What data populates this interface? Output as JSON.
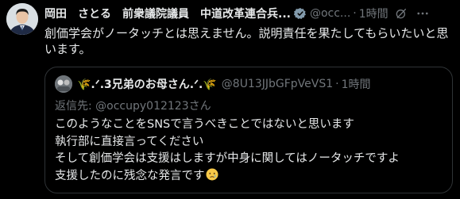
{
  "tweet": {
    "display_name": "岡田　さとる　前衆議院議員　中道改革連合兵...",
    "handle": "@occ...",
    "separator": "·",
    "time": "1時間",
    "text": "創価学会がノータッチとは思えません。説明責任を果たしてもらいたいと思います。"
  },
  "quote": {
    "display_name": "🌾.ᐟ.3兄弟のお母さん.ᐟ.🌾",
    "handle": "@8U13JJbGFpVeVS1",
    "separator": "·",
    "time": "1時間",
    "reply_prefix": "返信先: ",
    "reply_to": "@occupy012123さん",
    "lines": [
      "このようなことをSNSで言うべきことではないと思います",
      "執行部に直接言ってください",
      "そして創価学会は支援はしますが中身に関してはノータッチですよ",
      "支援したのに残念な発言です"
    ]
  },
  "icons": {
    "verified": "verified-badge-icon",
    "grok": "grok-icon",
    "more": "more-icon",
    "emoji": "crying-face-emoji"
  },
  "colors": {
    "background": "#000000",
    "text": "#e7e9ea",
    "muted": "#71767b",
    "border": "#2f3336",
    "verified": "#829aab"
  }
}
